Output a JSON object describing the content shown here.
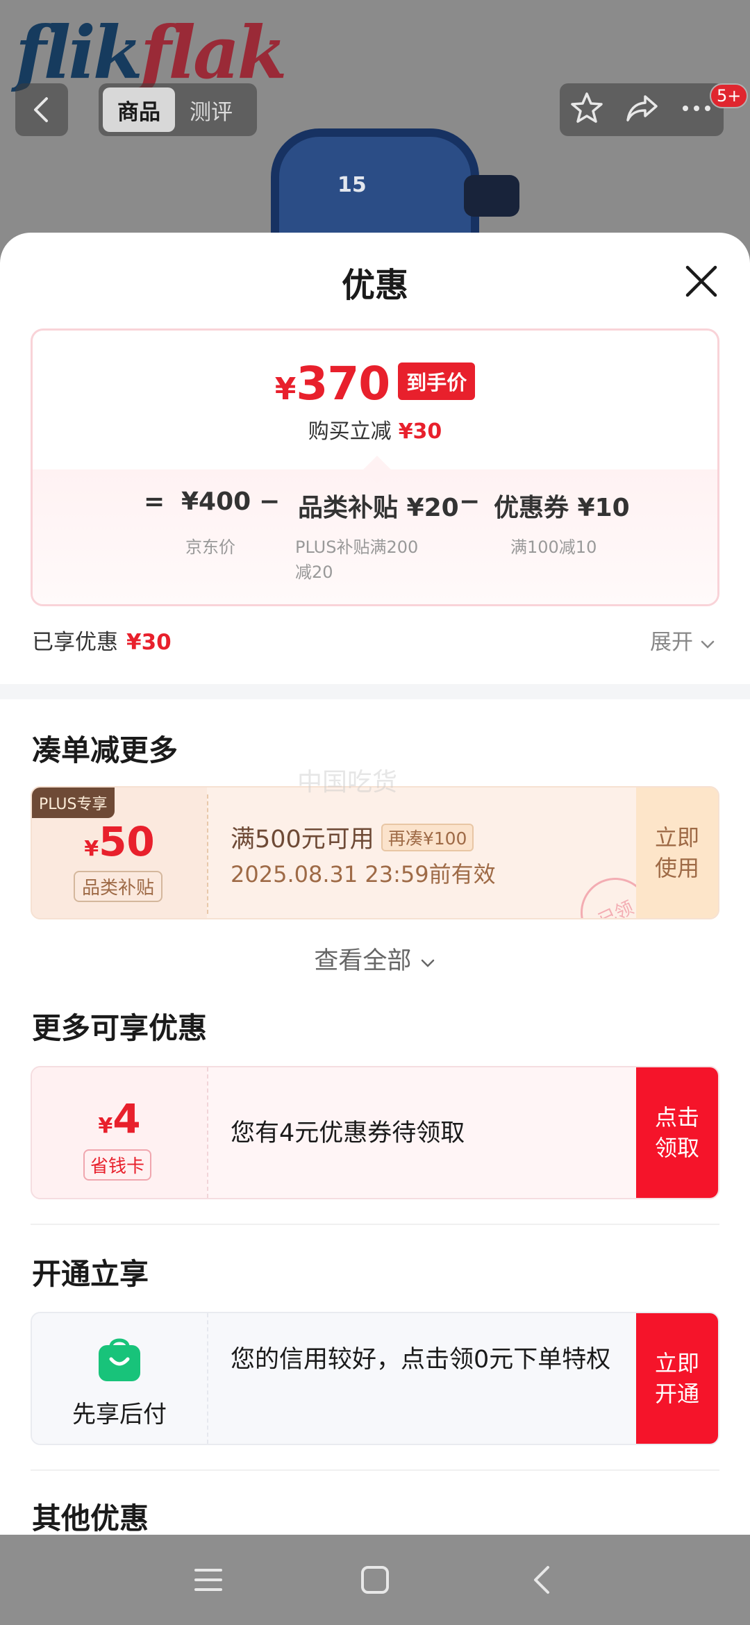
{
  "background": {
    "brand_logo_part1": "flik",
    "brand_logo_part2": "flak",
    "watch_number": "15",
    "tabs": [
      "商品",
      "测评"
    ],
    "active_tab": 0,
    "message_badge": "5+"
  },
  "sheet": {
    "title": "优惠",
    "price_card": {
      "currency": "¥",
      "final_price": "370",
      "final_price_tag": "到手价",
      "instant_discount_label": "购买立减",
      "instant_discount_value": "¥30",
      "formula": {
        "equals": "=",
        "jd_price": "¥400",
        "jd_price_note": "京东价",
        "minus1": "−",
        "subsidy": "品类补贴 ¥20",
        "subsidy_note_line1": "PLUS补贴满200",
        "subsidy_note_line2": "减20",
        "minus2": "−",
        "coupon": "优惠券 ¥10",
        "coupon_note": "满100减10"
      }
    },
    "enjoyed_label": "已享优惠",
    "enjoyed_value": "¥30",
    "expand_label": "展开",
    "section_more": "凑单减更多",
    "coupon_plus": {
      "tag": "PLUS专享",
      "currency": "¥",
      "amount": "50",
      "type": "品类补贴",
      "condition": "满500元可用",
      "add_more": "再凑¥100",
      "expiry": "2025.08.31 23:59前有效",
      "action_line1": "立即",
      "action_line2": "使用",
      "stamp": "已领"
    },
    "watermark": "中国吃货",
    "view_all": "查看全部",
    "section_extra": "更多可享优惠",
    "coupon_card": {
      "currency": "¥",
      "amount": "4",
      "label": "省钱卡",
      "text": "您有4元优惠券待领取",
      "action_line1": "点击",
      "action_line2": "领取"
    },
    "section_open": "开通立享",
    "paylater": {
      "label": "先享后付",
      "text": "您的信用较好，点击领0元下单特权",
      "action_line1": "立即",
      "action_line2": "开通"
    },
    "section_other": "其他优惠"
  },
  "colors": {
    "accent_red": "#e8202c",
    "cta_red": "#f5142a",
    "plus_brown": "#6e4a36",
    "paylater_green": "#18c37a"
  }
}
